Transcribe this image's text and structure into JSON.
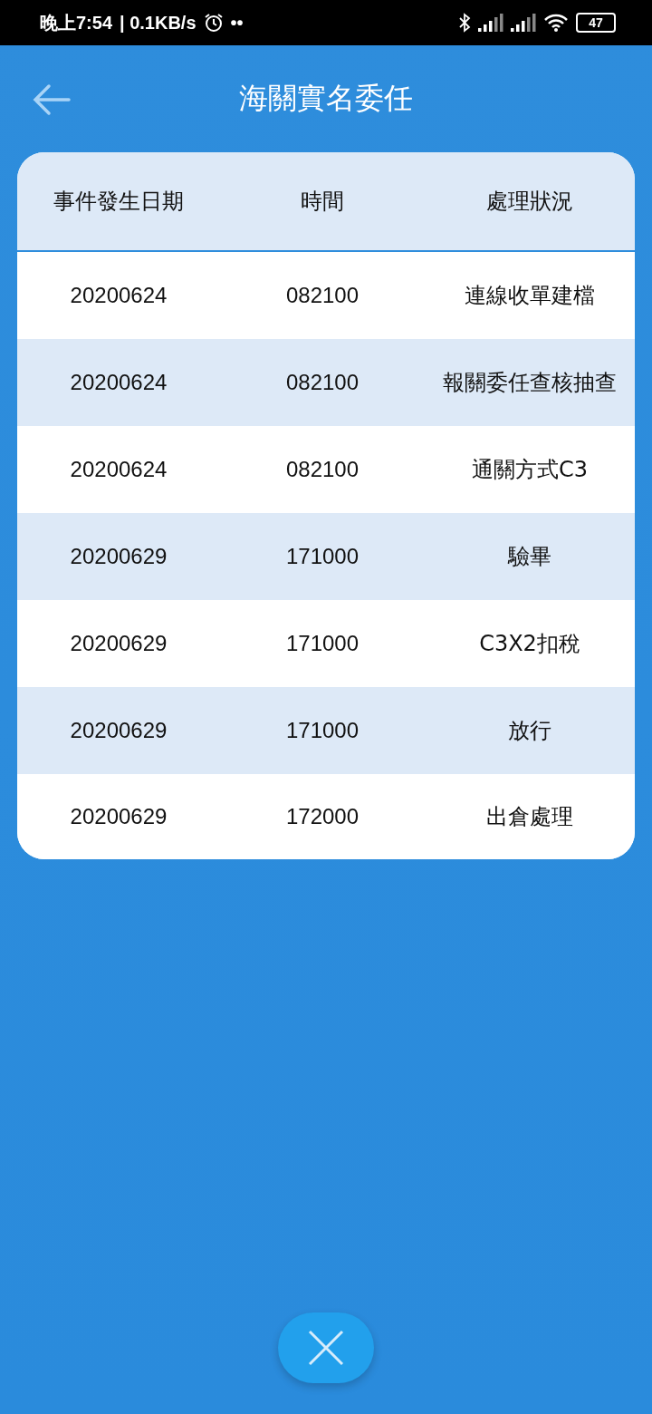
{
  "status_bar": {
    "time": "晚上7:54",
    "speed": "| 0.1KB/s",
    "notification_dots": "••",
    "battery": "47"
  },
  "header": {
    "title": "海關實名委任"
  },
  "table": {
    "columns": [
      "事件發生日期",
      "時間",
      "處理狀況"
    ],
    "rows": [
      [
        "20200624",
        "082100",
        "連線收單建檔"
      ],
      [
        "20200624",
        "082100",
        "報關委任查核抽查"
      ],
      [
        "20200624",
        "082100",
        "通關方式C3"
      ],
      [
        "20200629",
        "171000",
        "驗畢"
      ],
      [
        "20200629",
        "171000",
        "C3X2扣稅"
      ],
      [
        "20200629",
        "171000",
        "放行"
      ],
      [
        "20200629",
        "172000",
        "出倉處理"
      ]
    ]
  }
}
